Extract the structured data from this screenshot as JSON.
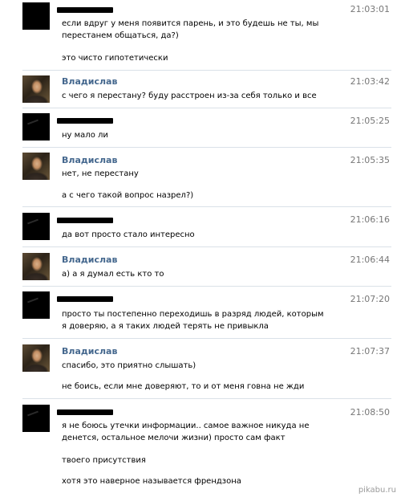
{
  "messages": [
    {
      "sender": "",
      "time": "21:03:01",
      "lines": [
        "если вдруг у меня появится парень, и это будешь не ты, мы перестанем общаться, да?)",
        "это чисто гипотетически"
      ]
    },
    {
      "sender": "Владислав",
      "time": "21:03:42",
      "lines": [
        "с чего я перестану? буду расстроен из-за себя только и все"
      ]
    },
    {
      "sender": "",
      "time": "21:05:25",
      "lines": [
        "ну мало ли"
      ]
    },
    {
      "sender": "Владислав",
      "time": "21:05:35",
      "lines": [
        "нет, не перестану",
        "а с чего такой вопрос назрел?)"
      ]
    },
    {
      "sender": "",
      "time": "21:06:16",
      "lines": [
        "да вот просто стало интересно"
      ]
    },
    {
      "sender": "Владислав",
      "time": "21:06:44",
      "lines": [
        "а) а я думал есть кто то"
      ]
    },
    {
      "sender": "",
      "time": "21:07:20",
      "lines": [
        "просто ты постепенно переходишь в разряд людей, которым я доверяю, а я таких людей терять не привыкла"
      ]
    },
    {
      "sender": "Владислав",
      "time": "21:07:37",
      "lines": [
        "спасибо, это приятно слышать)",
        "не боись, если мне доверяют, то и от меня говна не жди"
      ]
    },
    {
      "sender": "",
      "time": "21:08:50",
      "lines": [
        "я не боюсь утечки информации.. самое важное никуда не денется, остальное мелочи жизни) просто сам факт",
        "твоего присутствия",
        "хотя это наверное называется френдзона"
      ]
    }
  ],
  "watermark": "pikabu.ru"
}
